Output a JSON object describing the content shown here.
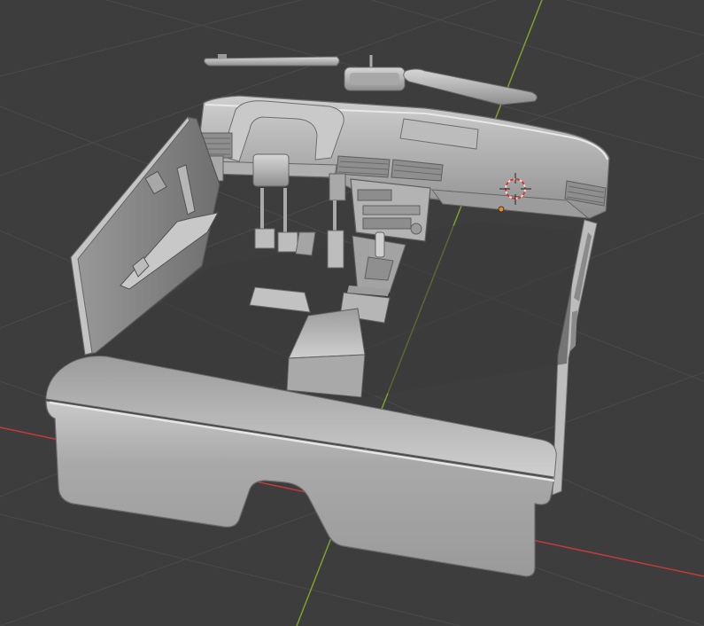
{
  "viewport": {
    "background_color": "#3d3d3d",
    "grid_line_color": "#4a4a4a",
    "axis_x_color": "#c23a3a",
    "axis_y_color": "#7fa02c",
    "model_color": "#b9b9b9"
  },
  "icons": {
    "origin_marker": "origin-marker-icon",
    "3d_cursor": "3d-cursor-icon"
  }
}
